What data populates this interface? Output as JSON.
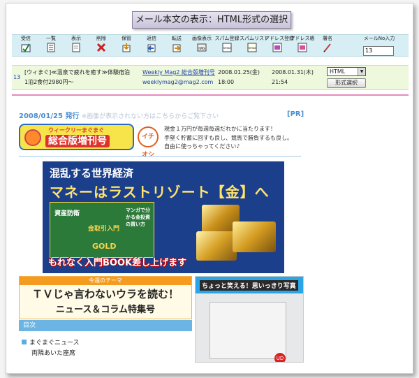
{
  "window": {
    "title": "メール本文の表示：HTML形式の選択"
  },
  "toolbar": {
    "items": [
      {
        "label": "受信",
        "icon": "receive-icon"
      },
      {
        "label": "一覧",
        "icon": "list-icon"
      },
      {
        "label": "表示",
        "icon": "view-icon"
      },
      {
        "label": "削除",
        "icon": "delete-icon"
      },
      {
        "label": "保管",
        "icon": "archive-icon"
      },
      {
        "label": "返信",
        "icon": "reply-icon"
      },
      {
        "label": "転送",
        "icon": "forward-icon"
      },
      {
        "label": "画像表示",
        "icon": "image-icon"
      },
      {
        "label": "スパム登録",
        "icon": "spam-register-icon"
      },
      {
        "label": "スパムリスト",
        "icon": "spam-list-icon"
      },
      {
        "label": "アドレス登録",
        "icon": "address-register-icon"
      },
      {
        "label": "アドレス帳",
        "icon": "address-book-icon"
      },
      {
        "label": "署名",
        "icon": "signature-icon"
      },
      {
        "label": "メールNo入力",
        "icon": ""
      }
    ],
    "mail_number": "13"
  },
  "mail": {
    "number": "13",
    "subject_line1": "[ウィまぐ]≪温泉で疲れを癒す≫体験宿泊",
    "subject_line2": "1泊2食付2980円〜",
    "from_name": "Weekly Mag2 総合版増刊号",
    "from_email": "weeklymag2@mag2.com",
    "sent_date": "2008.01.25(金)",
    "sent_time": "18:00",
    "received_date": "2008.01.31(木)",
    "received_time": "21:54",
    "format_value": "HTML",
    "format_button": "形式選択"
  },
  "content": {
    "issue_date": "2008/01/25 発行",
    "issue_note": "※画像が表示されない方はこちらからご覧下さい",
    "pr": "[PR]",
    "logo_top": "ウィークリーまぐまぐ",
    "logo_main": "総合版増刊号",
    "badge": "イチオシ",
    "promo_lines": [
      "現金１万円が毎週毎週だれかに当たります！",
      "手堅く貯蓄に回すも良し、競馬で勝負するも良し。",
      "自由に使っちゃってください♪"
    ],
    "ad_title1": "混乱する世界経済",
    "ad_title2": "マネーはラストリゾート【金】へ",
    "ad_book1": "資産防衛",
    "ad_book2": "金取引入門",
    "ad_book3": "マンガで分かる金投資の買い方",
    "ad_gold": "GOLD",
    "ad_footer": "もれなく入門BOOK差し上げます",
    "theme_tag": "今週のテーマ",
    "theme_line1": "ＴＶじゃ言わないウラを読む！",
    "theme_line2": "ニュース＆コラム特集号",
    "toc_title": "目次",
    "toc_item1": "まぐまぐニュース",
    "toc_item1_sub": "両隣あいた座席",
    "photo_header": "ちょっと笑える！思いっきり写真",
    "photo_badge": "UD"
  }
}
